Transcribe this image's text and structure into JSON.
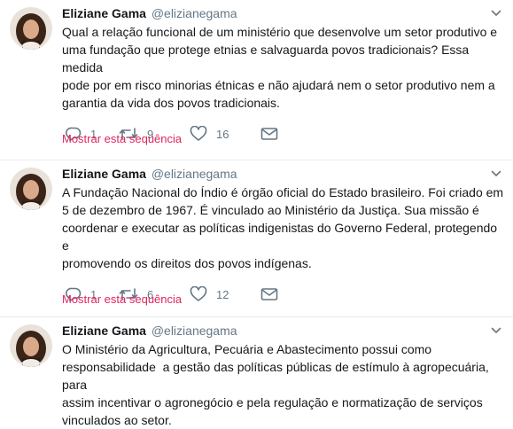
{
  "tweets": [
    {
      "name": "Eliziane Gama",
      "handle": "@elizianegama",
      "text": "Qual a relação funcional de um ministério que desenvolve um setor produtivo e\numa fundação que protege etnias e salvaguarda povos tradicionais? Essa medida\npode por em risco minorias étnicas e não ajudará nem o setor produtivo nem a\ngarantia da vida dos povos tradicionais.",
      "replies": "1",
      "retweets": "9",
      "likes": "16",
      "thread_link": "Mostrar esta sequência"
    },
    {
      "name": "Eliziane Gama",
      "handle": "@elizianegama",
      "text": "A Fundação Nacional do Índio é órgão oficial do Estado brasileiro. Foi criado em\n5 de dezembro de 1967. É vinculado ao Ministério da Justiça. Sua missão é\ncoordenar e executar as políticas indigenistas do Governo Federal, protegendo e\npromovendo os direitos dos povos indígenas.",
      "replies": "1",
      "retweets": "6",
      "likes": "12",
      "thread_link": "Mostrar esta sequência"
    },
    {
      "name": "Eliziane Gama",
      "handle": "@elizianegama",
      "text": "O Ministério da Agricultura, Pecuária e Abastecimento possui como\nresponsabilidade  a gestão das políticas públicas de estímulo à agropecuária, para\nassim incentivar o agronegócio e pela regulação e normatização de serviços\nvinculados ao setor."
    }
  ],
  "icons": {
    "reply": "reply-icon",
    "retweet": "retweet-icon",
    "like": "heart-icon",
    "dm": "envelope-icon",
    "menu": "chevron-down-icon"
  },
  "colors": {
    "name": "#14171a",
    "secondary": "#657786",
    "thread_link": "#e0245e",
    "divider": "#e6ecf0"
  }
}
